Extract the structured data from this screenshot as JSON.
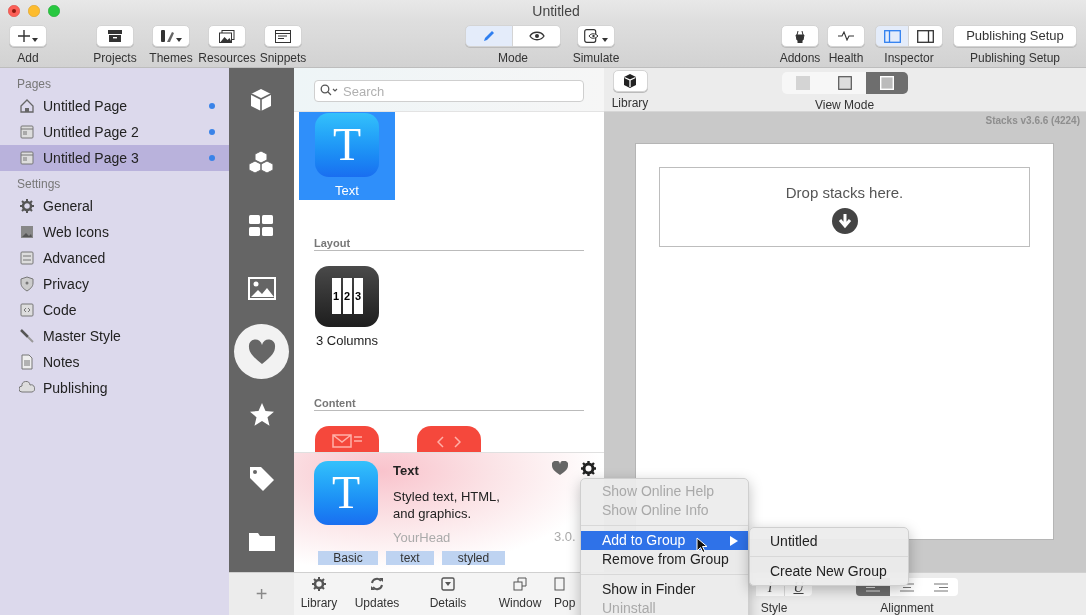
{
  "window": {
    "title": "Untitled"
  },
  "toolbar": {
    "add": {
      "label": "Add"
    },
    "tools": [
      {
        "label": "Projects"
      },
      {
        "label": "Themes"
      },
      {
        "label": "Resources"
      },
      {
        "label": "Snippets"
      }
    ],
    "mode": {
      "label": "Mode",
      "options": [
        {
          "selected": true
        },
        {
          "selected": false
        }
      ]
    },
    "simulate": {
      "label": "Simulate"
    },
    "addons": {
      "label": "Addons"
    },
    "health": {
      "label": "Health"
    },
    "inspector": {
      "label": "Inspector",
      "options": [
        {
          "selected": true
        },
        {
          "selected": false
        }
      ]
    },
    "publishing": {
      "button": "Publishing Setup",
      "label": "Publishing Setup"
    }
  },
  "sidebar": {
    "sections": [
      {
        "heading": "Pages",
        "items": [
          {
            "label": "Untitled Page",
            "selected": false,
            "modified": true
          },
          {
            "label": "Untitled Page 2",
            "selected": false,
            "modified": true
          },
          {
            "label": "Untitled Page 3",
            "selected": true,
            "modified": true
          }
        ]
      },
      {
        "heading": "Settings",
        "items": [
          {
            "label": "General",
            "selected": false,
            "modified": false
          },
          {
            "label": "Web Icons",
            "selected": false,
            "modified": false
          },
          {
            "label": "Advanced",
            "selected": false,
            "modified": false
          },
          {
            "label": "Privacy",
            "selected": false,
            "modified": false
          },
          {
            "label": "Code",
            "selected": false,
            "modified": false
          },
          {
            "label": "Master Style",
            "selected": false,
            "modified": false
          },
          {
            "label": "Notes",
            "selected": false,
            "modified": false
          },
          {
            "label": "Publishing",
            "selected": false,
            "modified": false
          }
        ]
      }
    ]
  },
  "rail": {
    "items": [
      {
        "selected": false
      },
      {
        "selected": false
      },
      {
        "selected": false
      },
      {
        "selected": false
      },
      {
        "selected": true
      },
      {
        "selected": false
      },
      {
        "selected": false
      },
      {
        "selected": false
      }
    ],
    "add_button": "+"
  },
  "library": {
    "search": {
      "placeholder": "Search"
    },
    "groups": [
      {
        "stacks": [
          {
            "kind": "text",
            "name": "Text",
            "glyph": "T",
            "selected": true
          }
        ]
      },
      {
        "heading": "Layout",
        "stacks": [
          {
            "kind": "columns",
            "name": "3 Columns",
            "digits": [
              "1",
              "2",
              "3"
            ],
            "selected": false
          }
        ]
      },
      {
        "heading": "Content",
        "stacks": [
          {
            "kind": "mail",
            "selected": false
          },
          {
            "kind": "code",
            "selected": false
          }
        ]
      }
    ],
    "detail": {
      "glyph": "T",
      "name": "Text",
      "description": "Styled text, HTML, and graphics.",
      "author": "YourHead",
      "version": "3.0.",
      "favorite": true,
      "tags": [
        "Basic",
        "text",
        "styled"
      ]
    },
    "bottom_tabs": [
      "Library",
      "Updates",
      "Details",
      "Window",
      "Pop"
    ]
  },
  "canvas": {
    "library_button": "Library",
    "view_mode": {
      "label": "View Mode",
      "options": [
        {
          "selected": false
        },
        {
          "selected": false
        },
        {
          "selected": true
        }
      ]
    },
    "version": "Stacks v3.6.6 (4224)",
    "drop_zone": "Drop stacks here.",
    "style": {
      "label": "Style",
      "options": [
        "I",
        "U"
      ]
    },
    "alignment": {
      "label": "Alignment",
      "options": [
        {
          "selected": true
        },
        {
          "selected": false
        },
        {
          "selected": false
        }
      ]
    }
  },
  "context_menu": {
    "items": [
      {
        "kind": "item",
        "label": "Show Online Help",
        "disabled": true,
        "selected": false,
        "submenu": false
      },
      {
        "kind": "item",
        "label": "Show Online Info",
        "disabled": true,
        "selected": false,
        "submenu": false
      },
      {
        "kind": "separator"
      },
      {
        "kind": "item",
        "label": "Add to Group",
        "disabled": false,
        "selected": true,
        "submenu": true
      },
      {
        "kind": "item",
        "label": "Remove from Group",
        "disabled": false,
        "selected": false,
        "submenu": false
      },
      {
        "kind": "separator"
      },
      {
        "kind": "item",
        "label": "Show in Finder",
        "disabled": false,
        "selected": false,
        "submenu": false
      },
      {
        "kind": "item",
        "label": "Uninstall",
        "disabled": true,
        "selected": false,
        "submenu": false
      }
    ],
    "submenu": [
      {
        "kind": "item",
        "label": "Untitled"
      },
      {
        "kind": "separator"
      },
      {
        "kind": "item",
        "label": "Create New Group"
      }
    ]
  }
}
